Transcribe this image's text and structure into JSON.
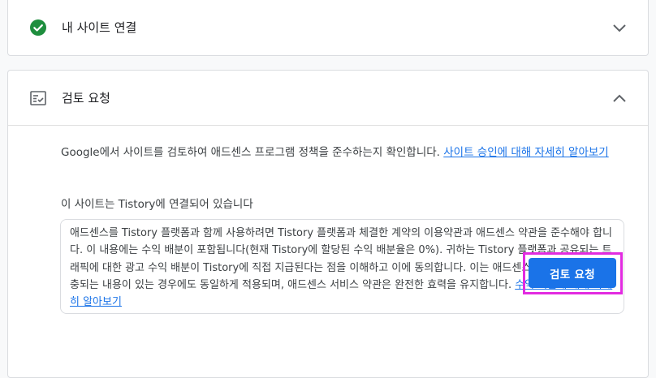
{
  "connect_section": {
    "title": "내 사이트 연결",
    "status_icon": "check-circle-icon",
    "status_color": "#1e8e3e",
    "expanded": false
  },
  "review_section": {
    "title": "검토 요청",
    "icon": "review-checklist-icon",
    "expanded": true,
    "description": "Google에서 사이트를 검토하여 애드센스 프로그램 정책을 준수하는지 확인합니다. ",
    "description_link": "사이트 승인에 대해 자세히 알아보기",
    "platform_notice": "이 사이트는 Tistory에 연결되어 있습니다",
    "terms_text": "애드센스를 Tistory 플랫폼과 함께 사용하려면 Tistory 플랫폼과 체결한 계약의 이용약관과 애드센스 약관을 준수해야 합니다. 이 내용에는 수익 배분이 포함됩니다(현재 Tistory에 할당된 수익 배분율은 0%). 귀하는 Tistory 플랫폼과 공유되는 트래픽에 대한 광고 수익 배분이 Tistory에 직접 지급된다는 점을 이해하고 이에 동의합니다. 이는 애드센스 서비스 약관에 상충되는 내용이 있는 경우에도 동일하게 적용되며, 애드센스 서비스 약관은 완전한 효력을 유지합니다. ",
    "terms_link": "수익 지분에 대해 자세히 알아보기",
    "button_label": "검토 요청"
  },
  "colors": {
    "accent": "#1a73e8",
    "highlight_border": "#e22be0"
  }
}
